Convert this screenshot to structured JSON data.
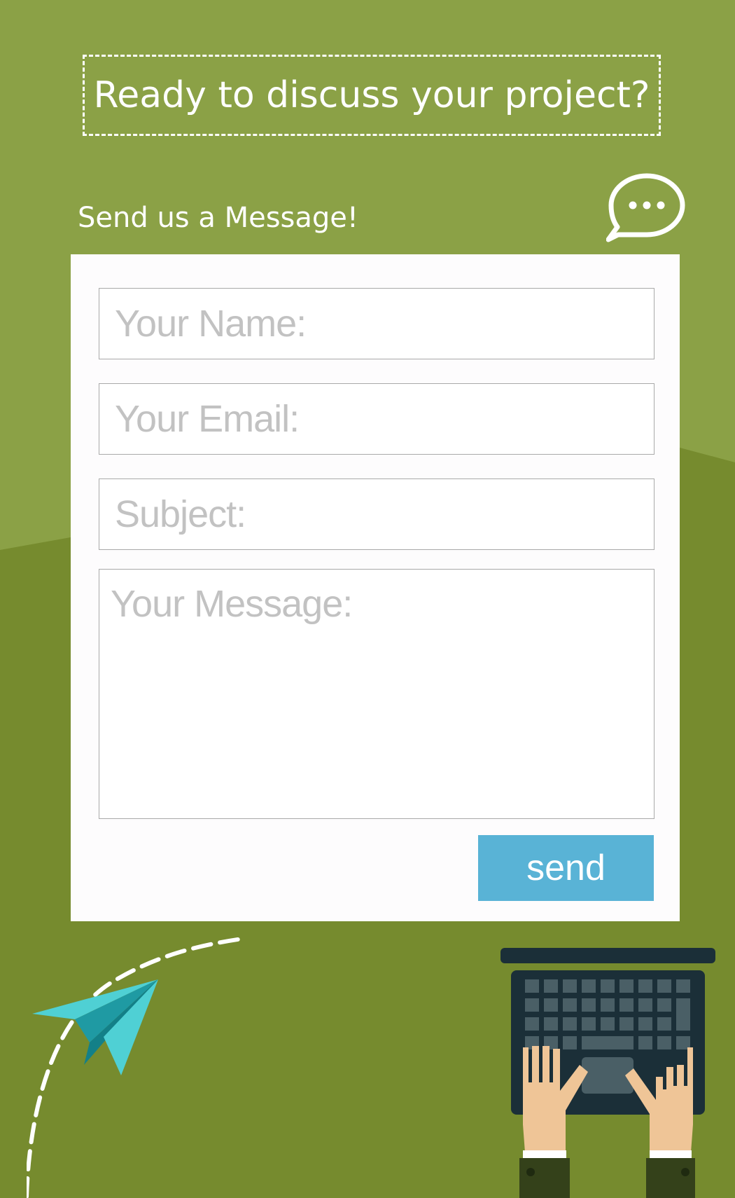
{
  "header": {
    "headline": "Ready to discuss your project?"
  },
  "contact": {
    "section_label": "Send us a Message!",
    "chat_icon": "chat-bubble-icon"
  },
  "form": {
    "name_placeholder": "Your Name:",
    "name_value": "",
    "email_placeholder": "Your Email:",
    "email_value": "",
    "subject_placeholder": "Subject:",
    "subject_value": "",
    "message_placeholder": "Your Message:",
    "message_value": "",
    "send_label": "send"
  },
  "illustrations": {
    "plane": "paper-plane-icon",
    "laptop": "laptop-typing-hands-icon"
  },
  "colors": {
    "background_light": "#8ba146",
    "background_dark": "#768b2e",
    "card": "#fdfcfd",
    "button": "#59b3d6",
    "plane_light": "#4fd0d4",
    "plane_dark": "#138088",
    "laptop": "#1b2f38",
    "hands": "#efc597"
  }
}
